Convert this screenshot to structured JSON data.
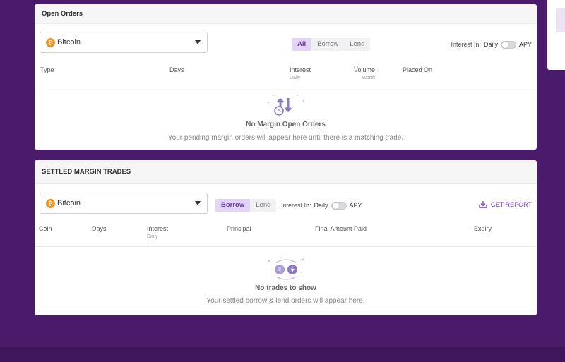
{
  "open_orders": {
    "title": "Open Orders",
    "coin_select": {
      "value": "Bitcoin",
      "coin_glyph": "₿"
    },
    "filters": [
      {
        "label": "All",
        "active": true
      },
      {
        "label": "Borrow",
        "active": false
      },
      {
        "label": "Lend",
        "active": false
      }
    ],
    "interest_toggle": {
      "label": "Interest In:",
      "left": "Daily",
      "right": "APY"
    },
    "columns": [
      {
        "label": "Type",
        "sub": ""
      },
      {
        "label": "Days",
        "sub": ""
      },
      {
        "label": "Interest",
        "sub": "Daily"
      },
      {
        "label": "Volume",
        "sub": "Worth"
      },
      {
        "label": "Placed On",
        "sub": ""
      }
    ],
    "empty": {
      "title": "No Margin Open Orders",
      "subtitle": "Your pending margin orders will appear here until there is a matching trade."
    }
  },
  "settled": {
    "title": "SETTLED MARGIN TRADES",
    "coin_select": {
      "value": "Bitcoin",
      "coin_glyph": "₿"
    },
    "filters": [
      {
        "label": "Borrow",
        "active": true
      },
      {
        "label": "Lend",
        "active": false
      }
    ],
    "interest_toggle": {
      "label": "Interest In:",
      "left": "Daily",
      "right": "APY"
    },
    "report_label": "GET REPORT",
    "columns": [
      {
        "label": "Coin",
        "sub": ""
      },
      {
        "label": "Days",
        "sub": ""
      },
      {
        "label": "Interest",
        "sub": "Daily"
      },
      {
        "label": "Principal",
        "sub": ""
      },
      {
        "label": "Final Amount Paid",
        "sub": ""
      },
      {
        "label": "Expiry",
        "sub": ""
      }
    ],
    "empty": {
      "title": "No trades to show",
      "subtitle": "Your settled borrow & lend orders will appear here."
    }
  },
  "colors": {
    "background": "#4a1a6b",
    "accent": "#7a3fc7",
    "coin": "#f7931a"
  }
}
